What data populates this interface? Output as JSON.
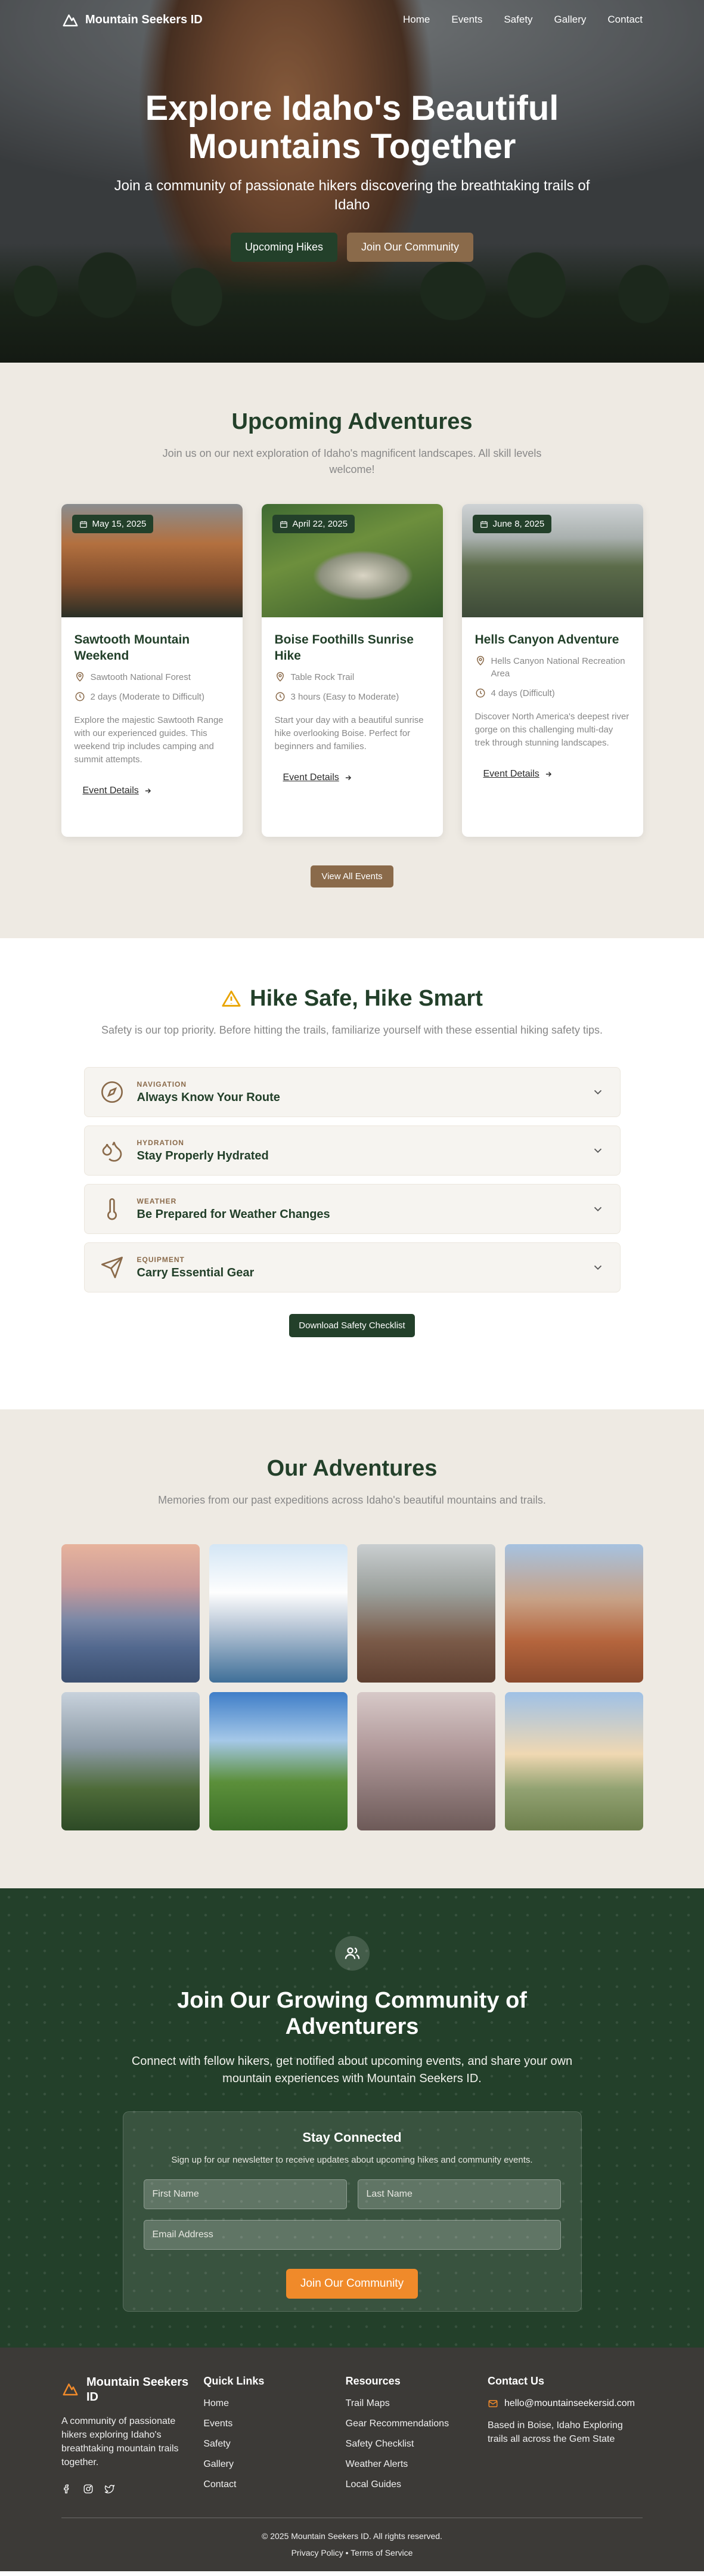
{
  "nav": {
    "brand": "Mountain Seekers ID",
    "links": [
      "Home",
      "Events",
      "Safety",
      "Gallery",
      "Contact"
    ]
  },
  "hero": {
    "title": "Explore Idaho's Beautiful Mountains Together",
    "subtitle": "Join a community of passionate hikers discovering the breathtaking trails of Idaho",
    "primary_button": "Upcoming Hikes",
    "secondary_button": "Join Our Community"
  },
  "adventures": {
    "title": "Upcoming Adventures",
    "subtitle": "Join us on our next exploration of Idaho's magnificent landscapes. All skill levels welcome!",
    "cards": [
      {
        "date": "May 15, 2025",
        "title": "Sawtooth Mountain Weekend",
        "location": "Sawtooth National Forest",
        "duration": "2 days (Moderate to Difficult)",
        "description": "Explore the majestic Sawtooth Range with our experienced guides. This weekend trip includes camping and summit attempts.",
        "link": "Event Details"
      },
      {
        "date": "April 22, 2025",
        "title": "Boise Foothills Sunrise Hike",
        "location": "Table Rock Trail",
        "duration": "3 hours (Easy to Moderate)",
        "description": "Start your day with a beautiful sunrise hike overlooking Boise. Perfect for beginners and families.",
        "link": "Event Details"
      },
      {
        "date": "June 8, 2025",
        "title": "Hells Canyon Adventure",
        "location": "Hells Canyon National Recreation Area",
        "duration": "4 days (Difficult)",
        "description": "Discover North America's deepest river gorge on this challenging multi-day trek through stunning landscapes.",
        "link": "Event Details"
      }
    ],
    "view_all": "View All Events"
  },
  "safety": {
    "title": "Hike Safe, Hike Smart",
    "subtitle": "Safety is our top priority. Before hitting the trails, familiarize yourself with these essential hiking safety tips.",
    "items": [
      {
        "category": "NAVIGATION",
        "title": "Always Know Your Route",
        "icon": "compass-icon"
      },
      {
        "category": "HYDRATION",
        "title": "Stay Properly Hydrated",
        "icon": "droplets-icon"
      },
      {
        "category": "WEATHER",
        "title": "Be Prepared for Weather Changes",
        "icon": "thermometer-icon"
      },
      {
        "category": "EQUIPMENT",
        "title": "Carry Essential Gear",
        "icon": "send-icon"
      }
    ],
    "download": "Download Safety Checklist"
  },
  "gallery": {
    "title": "Our Adventures",
    "subtitle": "Memories from our past expeditions across Idaho's beautiful mountains and trails."
  },
  "community": {
    "title": "Join Our Growing Community of Adventurers",
    "subtitle": "Connect with fellow hikers, get notified about upcoming events, and share your own mountain experiences with Mountain Seekers ID.",
    "newsletter_title": "Stay Connected",
    "newsletter_sub": "Sign up for our newsletter to receive updates about upcoming hikes and community events.",
    "first_name_placeholder": "First Name",
    "last_name_placeholder": "Last Name",
    "email_placeholder": "Email Address",
    "submit": "Join Our Community"
  },
  "footer": {
    "brand": "Mountain Seekers ID",
    "description": "A community of passionate hikers exploring Idaho's breathtaking mountain trails together.",
    "quick_links_title": "Quick Links",
    "quick_links": [
      "Home",
      "Events",
      "Safety",
      "Gallery",
      "Contact"
    ],
    "resources_title": "Resources",
    "resources": [
      "Trail Maps",
      "Gear Recommendations",
      "Safety Checklist",
      "Weather Alerts",
      "Local Guides"
    ],
    "contact_title": "Contact Us",
    "email": "hello@mountainseekersid.com",
    "address": "Based in Boise, Idaho Exploring trails all across the Gem State",
    "copyright": "© 2025 Mountain Seekers ID. All rights reserved.",
    "legal": "Privacy Policy • Terms of Service"
  },
  "colors": {
    "forest": "#23402a",
    "brown": "#8a6a4a",
    "sand": "#eeeae3",
    "orange": "#f08a2a",
    "footer": "#3c3a37"
  }
}
